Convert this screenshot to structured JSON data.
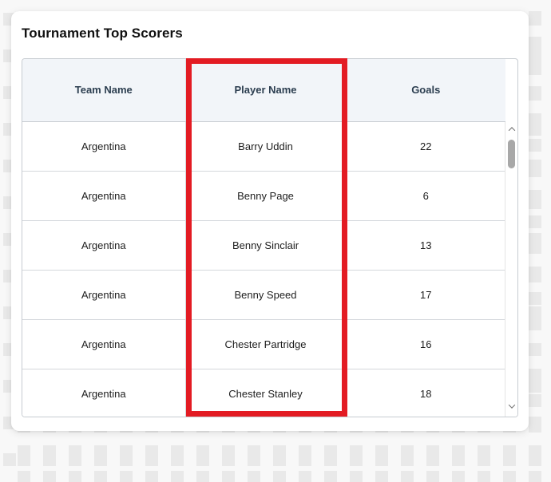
{
  "page": {
    "background_color": "#f8f8f8",
    "skeleton_block_color": "#e9e9e9"
  },
  "card": {
    "title": "Tournament Top Scorers",
    "background_color": "#ffffff"
  },
  "table": {
    "header_background": "#f2f5f9",
    "header_text_color": "#2c3e50",
    "border_color": "#c7ccd1",
    "columns": [
      {
        "key": "team_name",
        "label": "Team Name"
      },
      {
        "key": "player_name",
        "label": "Player Name"
      },
      {
        "key": "goals",
        "label": "Goals"
      }
    ],
    "rows": [
      {
        "team_name": "Argentina",
        "player_name": "Barry Uddin",
        "goals": "22"
      },
      {
        "team_name": "Argentina",
        "player_name": "Benny Page",
        "goals": "6"
      },
      {
        "team_name": "Argentina",
        "player_name": "Benny Sinclair",
        "goals": "13"
      },
      {
        "team_name": "Argentina",
        "player_name": "Benny Speed",
        "goals": "17"
      },
      {
        "team_name": "Argentina",
        "player_name": "Chester Partridge",
        "goals": "16"
      },
      {
        "team_name": "Argentina",
        "player_name": "Chester Stanley",
        "goals": "18"
      }
    ]
  },
  "scrollbar": {
    "orientation": "vertical",
    "up_arrow_icon": "chevron-up-icon",
    "down_arrow_icon": "chevron-down-icon",
    "thumb_color": "#a8a8a8"
  },
  "annotation": {
    "type": "highlight-rectangle",
    "color": "#e31b23",
    "target_column": "Player Name"
  }
}
